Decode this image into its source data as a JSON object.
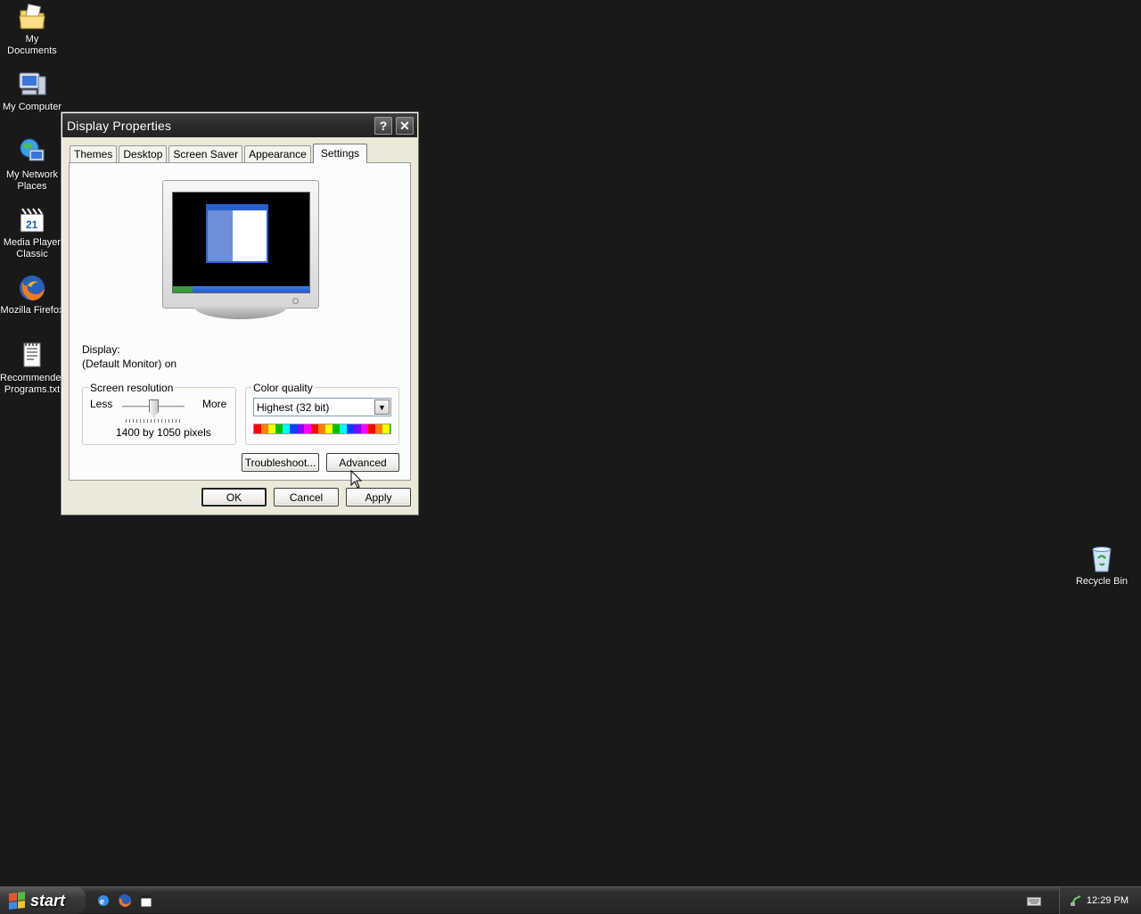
{
  "desktop": {
    "icons": [
      {
        "label": "My Documents",
        "icon": "my-documents-icon"
      },
      {
        "label": "My Computer",
        "icon": "my-computer-icon"
      },
      {
        "label": "My Network\nPlaces",
        "icon": "network-places-icon"
      },
      {
        "label": "Media Player\nClassic",
        "icon": "media-player-classic-icon"
      },
      {
        "label": "Mozilla Firefox",
        "icon": "firefox-icon"
      },
      {
        "label": "Recommended\nPrograms.txt",
        "icon": "text-file-icon"
      },
      {
        "label": "Recycle Bin",
        "icon": "recycle-bin-icon"
      }
    ]
  },
  "dialog": {
    "title": "Display Properties",
    "help_button": "?",
    "close_button": "✕",
    "tabs": [
      {
        "label": "Themes",
        "active": false
      },
      {
        "label": "Desktop",
        "active": false
      },
      {
        "label": "Screen Saver",
        "active": false
      },
      {
        "label": "Appearance",
        "active": false
      },
      {
        "label": "Settings",
        "active": true
      }
    ],
    "display_label": "Display:",
    "display_value": "(Default Monitor) on",
    "resolution": {
      "group_title": "Screen resolution",
      "less": "Less",
      "more": "More",
      "value_text": "1400 by 1050 pixels",
      "slider_position": 0.5
    },
    "color": {
      "group_title": "Color quality",
      "selected": "Highest (32 bit)"
    },
    "buttons": {
      "troubleshoot": "Troubleshoot...",
      "advanced": "Advanced",
      "ok": "OK",
      "cancel": "Cancel",
      "apply": "Apply"
    }
  },
  "taskbar": {
    "start_label": "start",
    "quick_launch": [
      "internet-explorer-icon",
      "firefox-icon",
      "media-player-classic-icon"
    ],
    "clock": "12:29 PM",
    "tray_icons": [
      "keyboard-icon",
      "network-icon"
    ]
  },
  "colors": {
    "desktop_bg": "#191919",
    "dialog_bg": "#ece9d8",
    "titlebar": "#2a2a2a"
  }
}
